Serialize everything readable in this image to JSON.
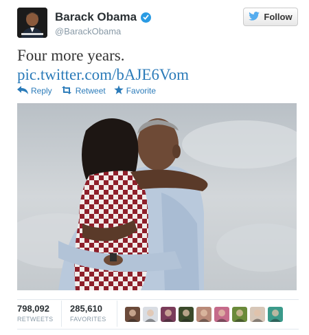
{
  "user": {
    "name": "Barack Obama",
    "handle": "@BarackObama",
    "verified": true
  },
  "follow": {
    "label": "Follow"
  },
  "tweet": {
    "text": "Four more years.",
    "link": "pic.twitter.com/bAJE6Vom"
  },
  "actions": {
    "reply": "Reply",
    "retweet": "Retweet",
    "favorite": "Favorite"
  },
  "stats": {
    "retweets": {
      "count": "798,092",
      "label": "RETWEETS"
    },
    "favorites": {
      "count": "285,610",
      "label": "FAVORITES"
    }
  },
  "favoriters": [
    {
      "name": "favoriter-avatar-1",
      "color": "#6b4a3a"
    },
    {
      "name": "favoriter-avatar-2",
      "color": "#d9dde3"
    },
    {
      "name": "favoriter-avatar-3",
      "color": "#7a3c5a"
    },
    {
      "name": "favoriter-avatar-4",
      "color": "#3b4a2a"
    },
    {
      "name": "favoriter-avatar-5",
      "color": "#b98a78"
    },
    {
      "name": "favoriter-avatar-6",
      "color": "#c56a8a"
    },
    {
      "name": "favoriter-avatar-7",
      "color": "#6a8a3a"
    },
    {
      "name": "favoriter-avatar-8",
      "color": "#d7c7b8"
    },
    {
      "name": "favoriter-avatar-9",
      "color": "#3a9a8a"
    }
  ],
  "colors": {
    "link": "#2b7bb9",
    "verified": "#2a9be3",
    "twitter_bird": "#55acee"
  }
}
